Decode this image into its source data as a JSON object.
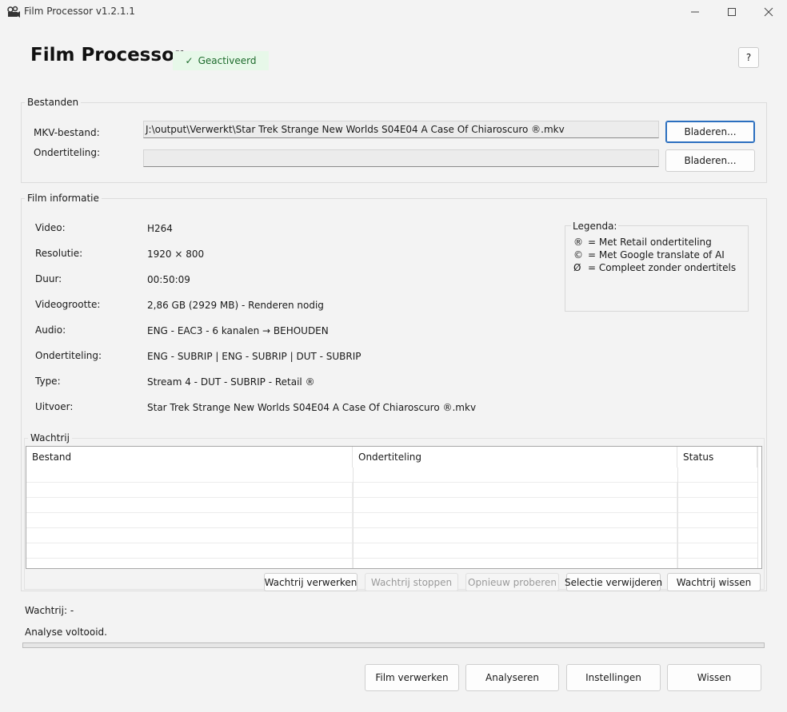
{
  "window": {
    "title": "Film Processor v1.2.1.1",
    "app_icon": "film-projector-icon"
  },
  "header": {
    "title": "Film Processor",
    "badge": "Geactiveerd",
    "badge_icon": "check-icon",
    "help_label": "?"
  },
  "files": {
    "group_label": "Bestanden",
    "mkv_label": "MKV-bestand:",
    "mkv_value": "J:\\output\\Verwerkt\\Star Trek Strange New Worlds S04E04 A Case Of Chiaroscuro ®.mkv",
    "subtitle_label": "Ondertiteling:",
    "subtitle_value": "",
    "browse_label": "Bladeren..."
  },
  "info": {
    "group_label": "Film informatie",
    "rows": [
      {
        "label": "Video:",
        "value": "H264"
      },
      {
        "label": "Resolutie:",
        "value": "1920 × 800"
      },
      {
        "label": "Duur:",
        "value": "00:50:09"
      },
      {
        "label": "Videogrootte:",
        "value": "2,86 GB (2929 MB) - Renderen nodig"
      },
      {
        "label": "Audio:",
        "value": "ENG - EAC3 - 6 kanalen → BEHOUDEN"
      },
      {
        "label": "Ondertiteling:",
        "value": "ENG - SUBRIP | ENG - SUBRIP | DUT - SUBRIP"
      },
      {
        "label": "Type:",
        "value": "Stream 4 - DUT - SUBRIP - Retail ®"
      },
      {
        "label": "Uitvoer:",
        "value": "Star Trek Strange New Worlds S04E04 A Case Of Chiaroscuro ®.mkv"
      }
    ]
  },
  "legend": {
    "title": "Legenda:",
    "items": [
      {
        "symbol": "®",
        "text": "= Met Retail ondertiteling"
      },
      {
        "symbol": "©",
        "text": "= Met Google translate of AI"
      },
      {
        "symbol": "Ø",
        "text": "= Compleet zonder ondertitels"
      }
    ]
  },
  "queue": {
    "group_label": "Wachtrij",
    "columns": [
      "Bestand",
      "Ondertiteling",
      "Status"
    ],
    "rows": [],
    "buttons": {
      "process": "Wachtrij verwerken",
      "stop": "Wachtrij stoppen",
      "retry": "Opnieuw proberen",
      "remove": "Selectie verwijderen",
      "clear": "Wachtrij wissen"
    }
  },
  "status": {
    "queue_text": "Wachtrij: -",
    "message": "Analyse voltooid.",
    "progress": 0
  },
  "footer": {
    "process_film": "Film verwerken",
    "analyze": "Analyseren",
    "settings": "Instellingen",
    "clear": "Wissen"
  }
}
